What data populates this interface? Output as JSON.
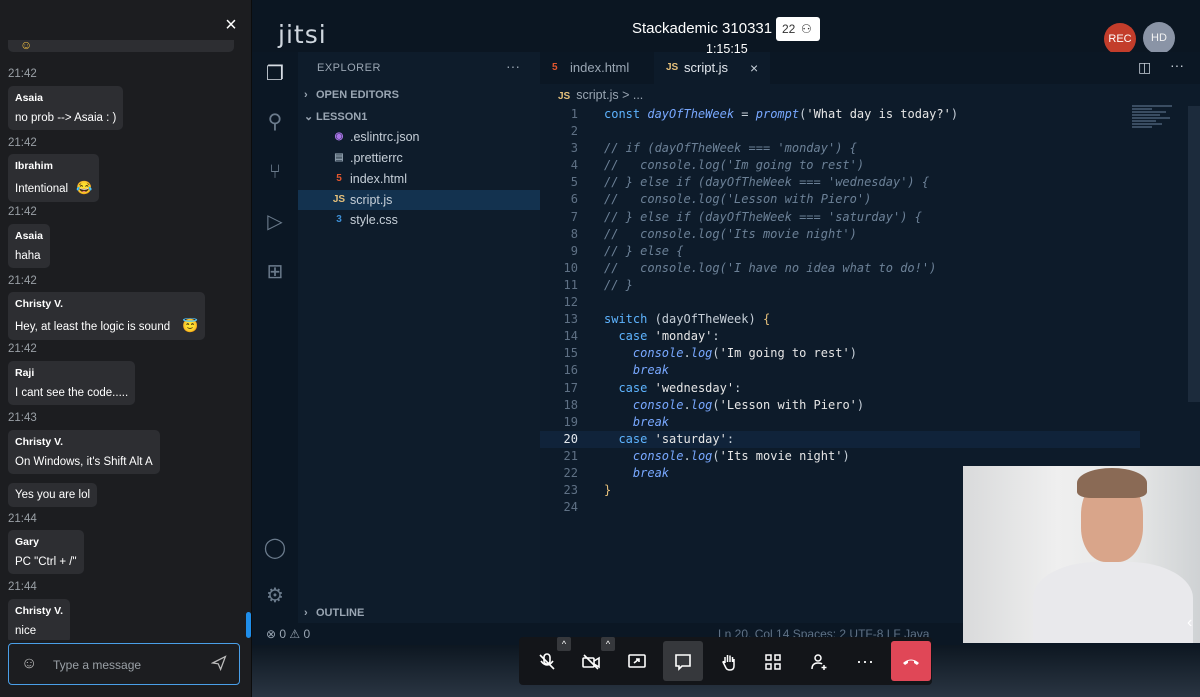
{
  "chat": {
    "close_label": "×",
    "messages": [
      {
        "time": "21:42"
      },
      {
        "name": "Asaia",
        "text": "no prob --> Asaia : )",
        "time": "21:42"
      },
      {
        "name": "Ibrahim",
        "text": "Intentional",
        "emoji": "😂",
        "time": "21:42"
      },
      {
        "name": "Asaia",
        "text": "haha",
        "time": "21:42"
      },
      {
        "name": "Christy V.",
        "text": "Hey, at least the logic is sound",
        "emoji": "😇",
        "time": "21:42"
      },
      {
        "name": "Raji",
        "text": "I cant see the code.....",
        "time": "21:43"
      },
      {
        "name": "Christy V.",
        "text": "On Windows, it's Shift Alt A"
      },
      {
        "text": "Yes you are lol",
        "time": "21:44"
      },
      {
        "name": "Gary",
        "text": "PC \"Ctrl + /\"",
        "time": "21:44"
      },
      {
        "name": "Christy V.",
        "text": "nice"
      }
    ],
    "input_placeholder": "Type a message"
  },
  "header": {
    "logo": "jitsi",
    "meeting_title": "Stackademic 310331",
    "participant_count": "22",
    "timer": "1:15:15",
    "rec_label": "REC",
    "avatar_initials": "HD"
  },
  "vscode": {
    "explorer_title": "EXPLORER",
    "more": "···",
    "open_editors": "OPEN EDITORS",
    "folder": "LESSON1",
    "files": [
      ".eslintrc.json",
      ".prettierrc",
      "index.html",
      "script.js",
      "style.css"
    ],
    "outline": "OUTLINE",
    "tabs": [
      "index.html",
      "script.js"
    ],
    "breadcrumb_file": "script.js",
    "breadcrumb_rest": "> ...",
    "status_left": "⊗ 0 ⚠ 0",
    "status_right": "Ln 20, Col 14    Spaces: 2    UTF-8    LF    Java",
    "current_line": 20
  },
  "accent_colors": {
    "rec": "#c33d2b",
    "hangup": "#e04757",
    "focus": "#4a9fe8"
  }
}
